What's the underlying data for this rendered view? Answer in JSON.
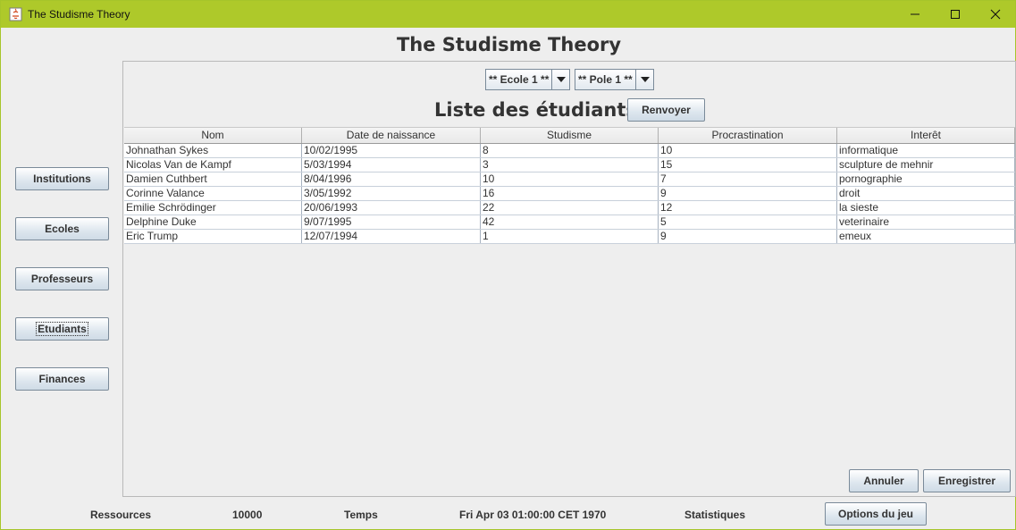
{
  "window": {
    "title": "The Studisme Theory",
    "titlebar_color": "#aec92a"
  },
  "app_title": "The Studisme Theory",
  "sidebar": {
    "items": [
      {
        "label": "Institutions"
      },
      {
        "label": "Ecoles"
      },
      {
        "label": "Professeurs"
      },
      {
        "label": "Etudiants"
      },
      {
        "label": "Finances"
      }
    ]
  },
  "filters": {
    "ecole": "** Ecole 1 **",
    "pole": "** Pole 1 **"
  },
  "list": {
    "title": "Liste des étudiants",
    "renvoyer_label": "Renvoyer"
  },
  "table": {
    "columns": [
      "Nom",
      "Date de naissance",
      "Studisme",
      "Procrastination",
      "Interêt"
    ],
    "rows": [
      [
        "Johnathan Sykes",
        "10/02/1995",
        "8",
        "10",
        "informatique"
      ],
      [
        "Nicolas Van de Kampf",
        "5/03/1994",
        "3",
        "15",
        "sculpture de mehnir"
      ],
      [
        "Damien Cuthbert",
        "8/04/1996",
        "10",
        "7",
        "pornographie"
      ],
      [
        "Corinne Valance",
        "3/05/1992",
        "16",
        "9",
        "droit"
      ],
      [
        "Emilie Schrödinger",
        "20/06/1993",
        "22",
        "12",
        "la sieste"
      ],
      [
        "Delphine Duke",
        "9/07/1995",
        "42",
        "5",
        "veterinaire"
      ],
      [
        "Eric Trump",
        "12/07/1994",
        "1",
        "9",
        "emeux"
      ]
    ]
  },
  "actions": {
    "annuler_label": "Annuler",
    "enregistrer_label": "Enregistrer"
  },
  "footer": {
    "ressources_label": "Ressources",
    "ressources_value": "10000",
    "temps_label": "Temps",
    "temps_value": "Fri Apr 03 01:00:00 CET 1970",
    "statistiques_label": "Statistiques",
    "options_label": "Options du jeu"
  }
}
